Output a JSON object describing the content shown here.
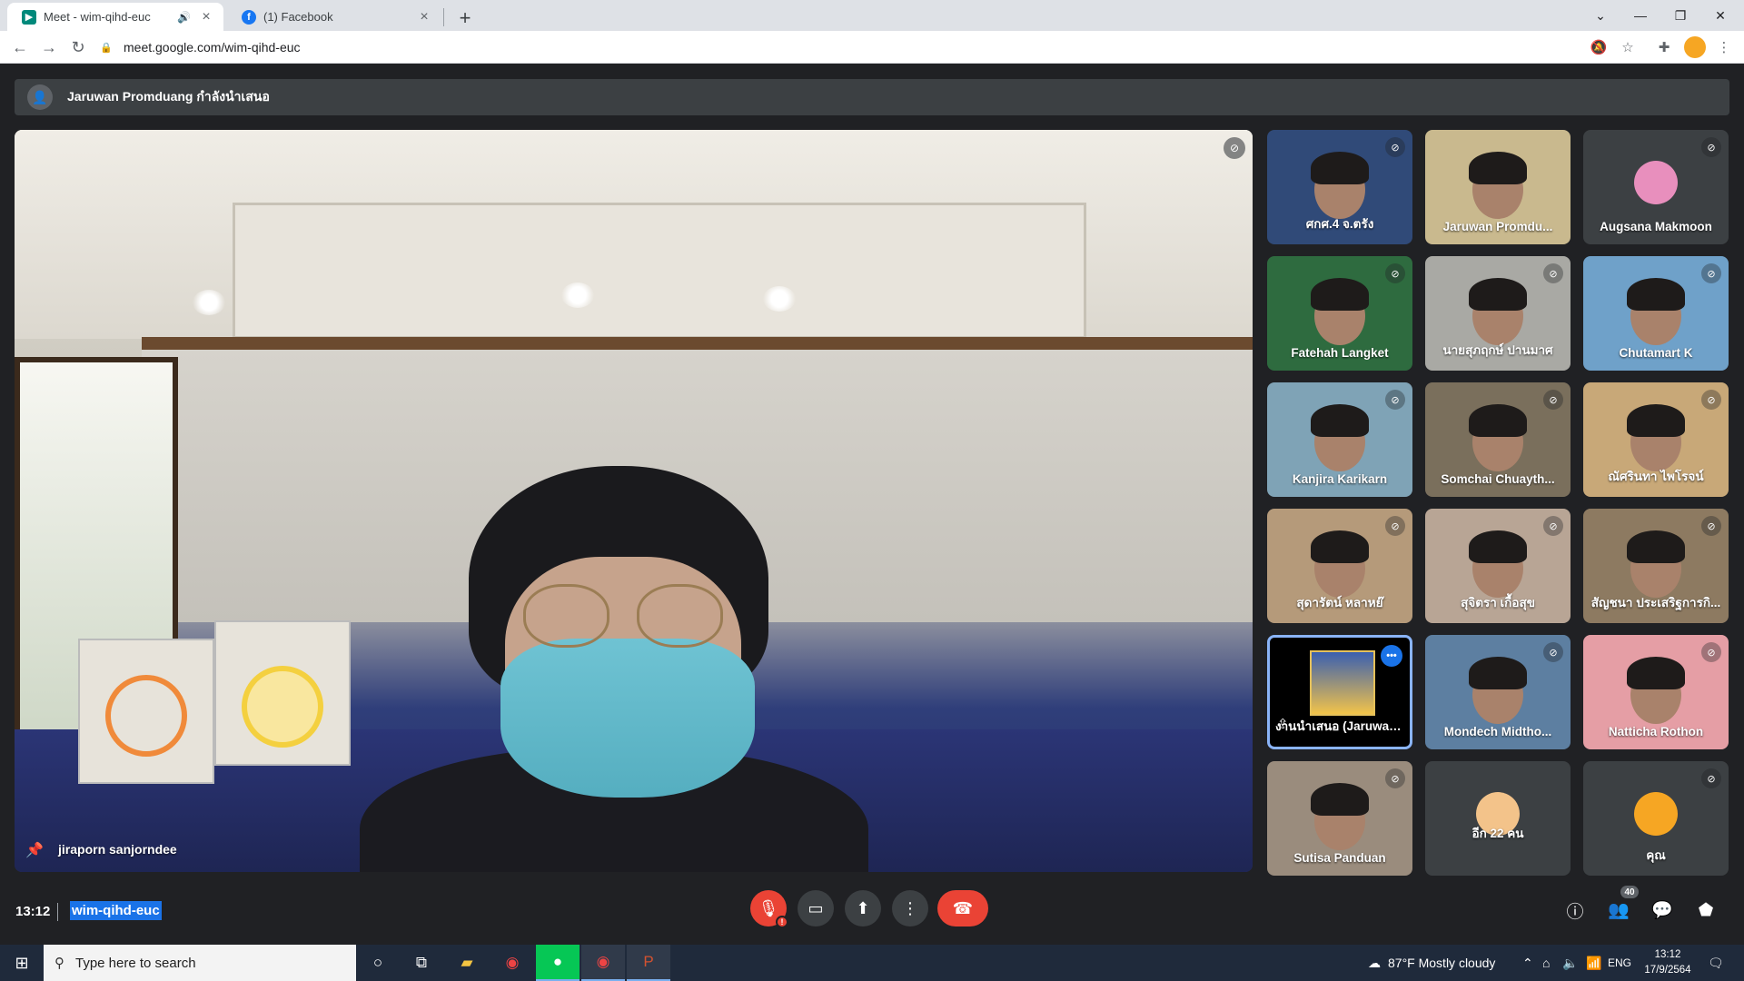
{
  "browser": {
    "tabs": [
      {
        "title": "Meet - wim-qihd-euc",
        "icon": "google-meet-icon",
        "active": true
      },
      {
        "title": "(1) Facebook",
        "icon": "facebook-icon",
        "active": false
      }
    ],
    "address": "meet.google.com/wim-qihd-euc",
    "accent": "#1a73e8"
  },
  "meet": {
    "presenting_text": "Jaruwan Promduang กำลังนำเสนอ",
    "main_speaker": "jiraporn sanjorndee",
    "tiles": [
      {
        "name": "ศกศ.4 จ.ตรัง",
        "mic": "mic-off-icon",
        "bg": "#304a78"
      },
      {
        "name": "Jaruwan Promdu...",
        "mic": "",
        "bg": "#c9b98e"
      },
      {
        "name": "Augsana Makmoon",
        "mic": "mic-off-icon",
        "bg": "#3c4043"
      },
      {
        "name": "Fatehah Langket",
        "mic": "mic-off-icon",
        "bg": "#2e6b3f"
      },
      {
        "name": "นายสุภฤกษ์ ปานมาศ",
        "mic": "mic-off-icon",
        "bg": "#a9a9a4"
      },
      {
        "name": "Chutamart K",
        "mic": "mic-off-icon",
        "bg": "#6fa1c9"
      },
      {
        "name": "Kanjira Karikarn",
        "mic": "mic-off-icon",
        "bg": "#7fa3b6"
      },
      {
        "name": "Somchai Chuayth...",
        "mic": "mic-off-icon",
        "bg": "#7a6f5c"
      },
      {
        "name": "ณัศรินทา ไพโรจน์",
        "mic": "mic-off-icon",
        "bg": "#c8a878"
      },
      {
        "name": "สุดารัตน์ หลาหย๊",
        "mic": "mic-off-icon",
        "bg": "#b59a7a"
      },
      {
        "name": "สุจิตรา เกื้อสุข",
        "mic": "mic-off-icon",
        "bg": "#b8a595"
      },
      {
        "name": "สัญชนา ประเสริฐการกิ...",
        "mic": "mic-off-icon",
        "bg": "#8d7a61"
      },
      {
        "name": "งานนำเสนอ (Jaruwan Pr...",
        "mic": "more-options-icon",
        "bg": "#000000"
      },
      {
        "name": "Mondech Midtho...",
        "mic": "mic-off-icon",
        "bg": "#5d7fa1"
      },
      {
        "name": "Natticha Rothon",
        "mic": "mic-off-icon",
        "bg": "#e59ea5"
      },
      {
        "name": "Sutisa Panduan",
        "mic": "mic-off-icon",
        "bg": "#9a8c7d"
      },
      {
        "name": "อีก 22 คน",
        "mic": "",
        "bg": "#3c4043"
      },
      {
        "name": "คุณ",
        "mic": "mic-off-icon",
        "bg": "#3c4043"
      }
    ],
    "time": "13:12",
    "meeting_code": "wim-qihd-euc",
    "participant_count": "40"
  },
  "taskbar": {
    "search_placeholder": "Type here to search",
    "weather": "87°F  Mostly cloudy",
    "lang": "ENG",
    "time": "13:12",
    "date": "17/9/2564"
  }
}
